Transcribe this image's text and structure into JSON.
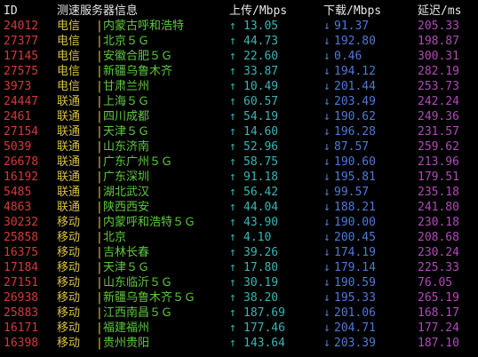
{
  "header": {
    "id": "ID",
    "node": "测速服务器信息",
    "upload": "上传/Mbps",
    "download": "下载/Mbps",
    "latency": "延迟/ms"
  },
  "symbols": {
    "separator": "|",
    "up_arrow": "↑",
    "down_arrow": "↓"
  },
  "colors": {
    "background": "#000000",
    "id": "#d23a3a",
    "isp": "#d8c040",
    "node": "#5fc83c",
    "upload": "#3ab4b4",
    "download": "#4f78d8",
    "latency": "#b04ab8"
  },
  "rows": [
    {
      "id": "24012",
      "isp": "电信",
      "node": "内蒙古呼和浩特",
      "up": "13.05",
      "down": "91.37",
      "latency": "205.33"
    },
    {
      "id": "27377",
      "isp": "电信",
      "node": "北京５Ｇ",
      "up": "44.73",
      "down": "192.80",
      "latency": "198.87"
    },
    {
      "id": "17145",
      "isp": "电信",
      "node": "安徽合肥５Ｇ",
      "up": "22.60",
      "down": "0.46",
      "latency": "300.31"
    },
    {
      "id": "27575",
      "isp": "电信",
      "node": "新疆乌鲁木齐",
      "up": "33.87",
      "down": "194.12",
      "latency": "282.19"
    },
    {
      "id": "3973",
      "isp": "电信",
      "node": "甘肃兰州",
      "up": "10.49",
      "down": "201.44",
      "latency": "253.73"
    },
    {
      "id": "24447",
      "isp": "联通",
      "node": "上海５Ｇ",
      "up": "60.57",
      "down": "203.49",
      "latency": "242.24"
    },
    {
      "id": "2461",
      "isp": "联通",
      "node": "四川成都",
      "up": "54.19",
      "down": "190.62",
      "latency": "249.36"
    },
    {
      "id": "27154",
      "isp": "联通",
      "node": "天津５Ｇ",
      "up": "14.60",
      "down": "196.28",
      "latency": "231.57"
    },
    {
      "id": "5039",
      "isp": "联通",
      "node": "山东济南",
      "up": "52.96",
      "down": "87.57",
      "latency": "259.62"
    },
    {
      "id": "26678",
      "isp": "联通",
      "node": "广东广州５Ｇ",
      "up": "58.75",
      "down": "190.60",
      "latency": "213.96"
    },
    {
      "id": "16192",
      "isp": "联通",
      "node": "广东深圳",
      "up": "91.18",
      "down": "195.81",
      "latency": "179.51"
    },
    {
      "id": "5485",
      "isp": "联通",
      "node": "湖北武汉",
      "up": "56.42",
      "down": "99.57",
      "latency": "235.18"
    },
    {
      "id": "4863",
      "isp": "联通",
      "node": "陕西西安",
      "up": "44.04",
      "down": "188.21",
      "latency": "241.80"
    },
    {
      "id": "30232",
      "isp": "移动",
      "node": "内蒙呼和浩特５Ｇ",
      "up": "43.90",
      "down": "190.00",
      "latency": "230.18"
    },
    {
      "id": "25858",
      "isp": "移动",
      "node": "北京",
      "up": "4.10",
      "down": "200.45",
      "latency": "208.68"
    },
    {
      "id": "16375",
      "isp": "移动",
      "node": "吉林长春",
      "up": "39.26",
      "down": "174.19",
      "latency": "230.24"
    },
    {
      "id": "17184",
      "isp": "移动",
      "node": "天津５Ｇ",
      "up": "17.80",
      "down": "179.14",
      "latency": "225.33"
    },
    {
      "id": "27151",
      "isp": "移动",
      "node": "山东临沂５Ｇ",
      "up": "30.19",
      "down": "190.59",
      "latency": "76.05"
    },
    {
      "id": "26938",
      "isp": "移动",
      "node": "新疆乌鲁木齐５Ｇ",
      "up": "38.20",
      "down": "195.33",
      "latency": "265.19"
    },
    {
      "id": "25883",
      "isp": "移动",
      "node": "江西南昌５Ｇ",
      "up": "187.69",
      "down": "201.06",
      "latency": "168.17"
    },
    {
      "id": "16171",
      "isp": "移动",
      "node": "福建福州",
      "up": "177.46",
      "down": "204.71",
      "latency": "177.24"
    },
    {
      "id": "16398",
      "isp": "移动",
      "node": "贵州贵阳",
      "up": "143.64",
      "down": "203.39",
      "latency": "187.10"
    }
  ]
}
